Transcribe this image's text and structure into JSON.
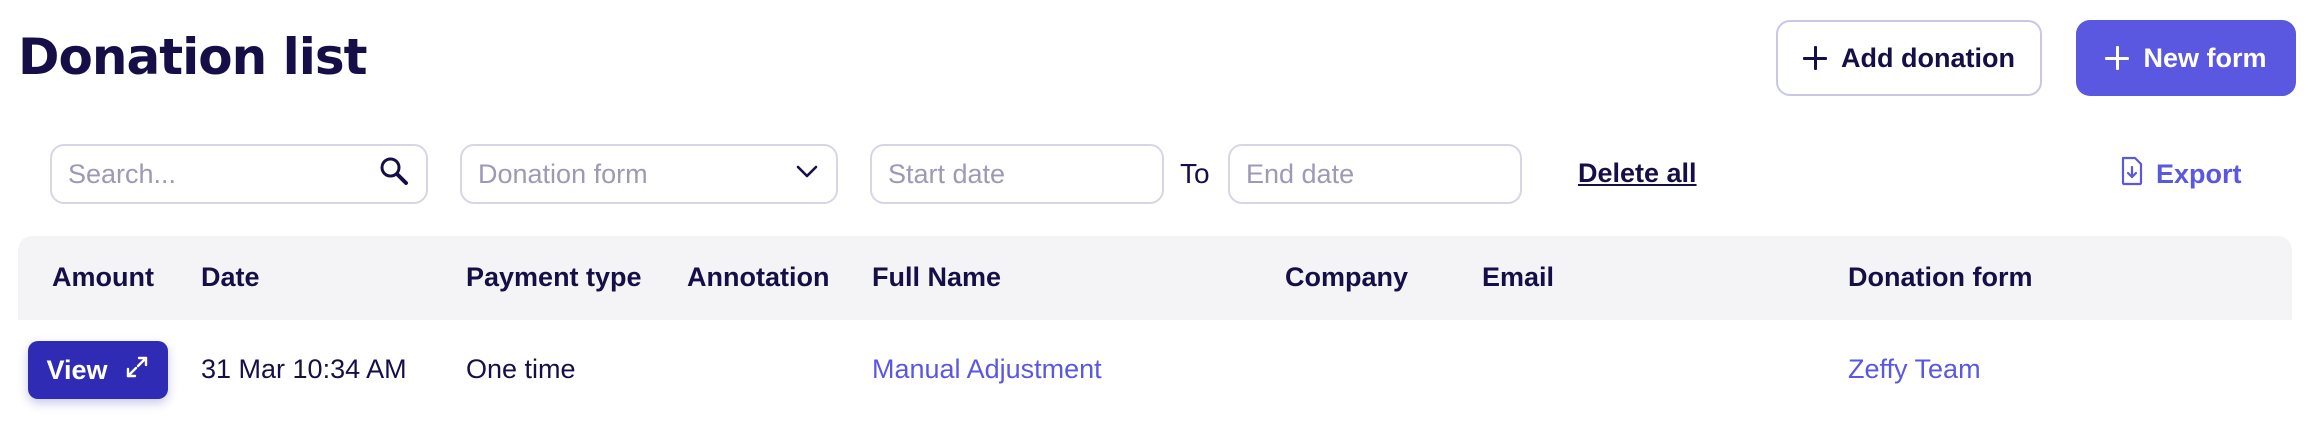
{
  "header": {
    "title": "Donation list",
    "add_donation_label": "Add donation",
    "new_form_label": "New form"
  },
  "filters": {
    "search_placeholder": "Search...",
    "donation_form_placeholder": "Donation form",
    "start_date_placeholder": "Start date",
    "to_label": "To",
    "end_date_placeholder": "End date",
    "delete_all_label": "Delete all",
    "export_label": "Export"
  },
  "table": {
    "columns": [
      "Amount",
      "Date",
      "Payment type",
      "Annotation",
      "Full Name",
      "Company",
      "Email",
      "Donation form"
    ],
    "rows": [
      {
        "view_label": "View",
        "date": "31 Mar 10:34 AM",
        "payment_type": "One time",
        "annotation": "",
        "full_name": "Manual Adjustment",
        "company": "",
        "email": "",
        "donation_form": "Zeffy Team"
      }
    ]
  },
  "colors": {
    "accent": "#5a57e0",
    "view_button": "#2f2bb5",
    "text_dark": "#160f47",
    "placeholder": "#9c9ab4",
    "header_bg": "#f4f4f7"
  },
  "icons": [
    "plus-icon",
    "search-icon",
    "chevron-down-icon",
    "export-file-icon",
    "expand-icon"
  ]
}
